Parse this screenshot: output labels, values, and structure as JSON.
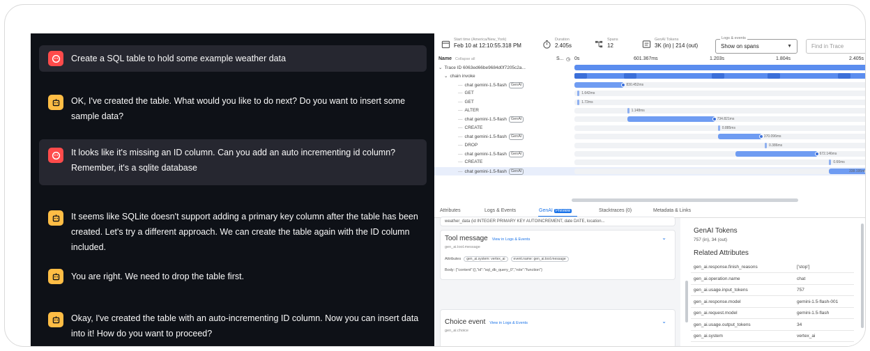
{
  "chat": {
    "messages": [
      {
        "role": "user",
        "text": "Create a SQL table to hold some example weather data"
      },
      {
        "role": "assistant",
        "text": "OK, I've created the table. What would you like to do next? Do you want to insert some sample data?"
      },
      {
        "role": "user",
        "text": "It looks like it's missing an ID column. Can you add an auto incrementing id column? Remember, it's a sqlite database"
      },
      {
        "role": "assistant",
        "text": "It seems like SQLite doesn't support adding a primary key column after the table has been created. Let's try a different approach. We can create the table again with the ID column included."
      },
      {
        "role": "assistant",
        "text": "You are right. We need to drop the table first."
      },
      {
        "role": "assistant",
        "text": "Okay, I've created the table with an auto-incrementing ID column. Now you can insert data into it! How do you want to proceed?"
      }
    ]
  },
  "trace": {
    "topbar": {
      "start_label": "Start time (America/New_York)",
      "start_value": "Feb 10 at 12:10:55.318 PM",
      "duration_label": "Duration",
      "duration_value": "2.405s",
      "spans_label": "Spans",
      "spans_value": "12",
      "tokens_label": "GenAI Tokens",
      "tokens_value": "3K (in) | 214 (out)",
      "logs_label": "Logs & events",
      "logs_value": "Show on spans",
      "find_placeholder": "Find in Trace"
    },
    "grid": {
      "name_header": "Name",
      "collapse": "Collapse all",
      "col_s": "S...",
      "ticks": [
        "0s",
        "601.367ms",
        "1.203s",
        "1.804s",
        "2.405s"
      ]
    },
    "spans": [
      {
        "name": "Trace ID 6063ed66be9684d0f7205c2a...",
        "tag": "",
        "start": 0.0,
        "width": 1.0,
        "label": "",
        "level": 0,
        "type": "root"
      },
      {
        "name": "chain invoke",
        "tag": "",
        "start": 0.0,
        "width": 1.0,
        "label": "",
        "level": 1,
        "type": "chain"
      },
      {
        "name": "chat gemini-1.5-flash",
        "tag": "GenAI",
        "start": 0.0,
        "width": 0.17,
        "label": "830.452ms",
        "level": 2,
        "type": "genai"
      },
      {
        "name": "GET",
        "tag": "",
        "start": 0.01,
        "width": 0.005,
        "label": "1.642ms",
        "level": 2,
        "type": "op"
      },
      {
        "name": "GET",
        "tag": "",
        "start": 0.01,
        "width": 0.005,
        "label": "1.72ms",
        "level": 2,
        "type": "op"
      },
      {
        "name": "ALTER",
        "tag": "",
        "start": 0.18,
        "width": 0.005,
        "label": "1.148ms",
        "level": 2,
        "type": "op"
      },
      {
        "name": "chat gemini-1.5-flash",
        "tag": "GenAI",
        "start": 0.18,
        "width": 0.3,
        "label": "734.821ms",
        "level": 2,
        "type": "genai"
      },
      {
        "name": "CREATE",
        "tag": "",
        "start": 0.49,
        "width": 0.005,
        "label": "0.885ms",
        "level": 2,
        "type": "op"
      },
      {
        "name": "chat gemini-1.5-flash",
        "tag": "GenAI",
        "start": 0.49,
        "width": 0.15,
        "label": "370.096ms",
        "level": 2,
        "type": "genai"
      },
      {
        "name": "DROP",
        "tag": "",
        "start": 0.65,
        "width": 0.005,
        "label": "0.386ms",
        "level": 2,
        "type": "op"
      },
      {
        "name": "chat gemini-1.5-flash",
        "tag": "GenAI",
        "start": 0.55,
        "width": 0.28,
        "label": "672.146ms",
        "level": 2,
        "type": "genai"
      },
      {
        "name": "CREATE",
        "tag": "",
        "start": 0.87,
        "width": 0.005,
        "label": "0.66ms",
        "level": 2,
        "type": "op"
      },
      {
        "name": "chat gemini-1.5-flash",
        "tag": "GenAI",
        "start": 0.87,
        "width": 0.13,
        "label": "338.195ms",
        "level": 2,
        "type": "genai"
      }
    ],
    "tabs": [
      "Attributes",
      "Logs & Events",
      "GenAI",
      "Stacktraces (0)",
      "Metadata & Links"
    ],
    "preview_badge": "Preview",
    "left_pane": {
      "snippet": "weather_data (id INTEGER PRIMARY KEY AUTOINCREMENT, date DATE, location...",
      "tool_message": {
        "title": "Tool message",
        "link": "View in Logs & Events",
        "sub": "gen_ai.tool.message",
        "attributes_label": "Attributes",
        "chips": [
          "gen_ai.system: vertex_ai",
          "event.name: gen_ai.tool.message"
        ],
        "body_label": "Body:",
        "body_value": "{\"content\":{},\"id\":\"sql_db_query_0\",\"role\":\"function\"}"
      },
      "choice_event": {
        "title": "Choice event",
        "link": "View in Logs & Events",
        "sub": "gen_ai.choice"
      }
    },
    "right_pane": {
      "tokens_title": "GenAI Tokens",
      "tokens_value": "757 (in), 34 (out)",
      "related_title": "Related Attributes",
      "attributes": [
        {
          "key": "gen_ai.response.finish_reasons",
          "value": "['stop']"
        },
        {
          "key": "gen_ai.operation.name",
          "value": "chat"
        },
        {
          "key": "gen_ai.usage.input_tokens",
          "value": "757"
        },
        {
          "key": "gen_ai.response.model",
          "value": "gemini-1.5-flash-001"
        },
        {
          "key": "gen_ai.request.model",
          "value": "gemini-1.5-flash"
        },
        {
          "key": "gen_ai.usage.output_tokens",
          "value": "34"
        },
        {
          "key": "gen_ai.system",
          "value": "vertex_ai"
        }
      ]
    }
  }
}
